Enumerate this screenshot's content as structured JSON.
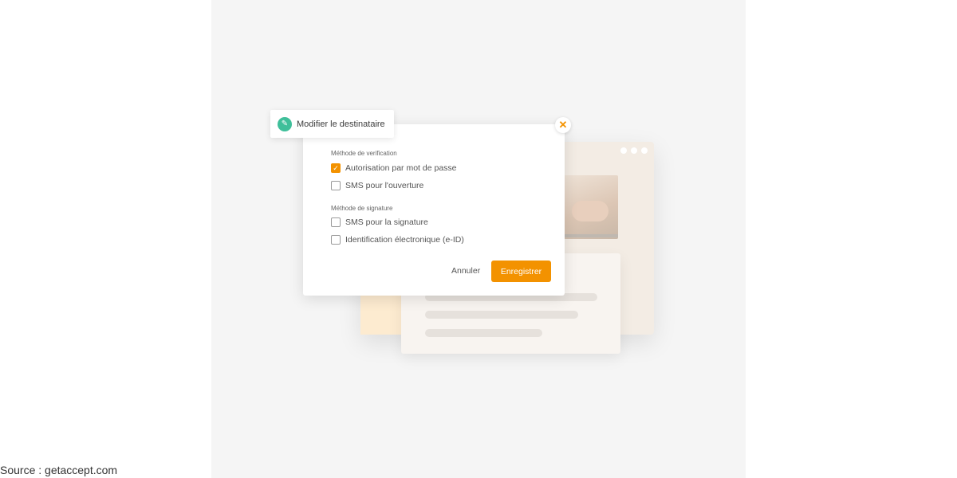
{
  "dialog": {
    "title": "Modifier le destinataire",
    "verification_label": "Méthode de verification",
    "verification_options": [
      {
        "label": "Autorisation par mot de passe",
        "checked": true
      },
      {
        "label": "SMS pour l'ouverture",
        "checked": false
      }
    ],
    "signature_label": "Méthode de signature",
    "signature_options": [
      {
        "label": "SMS pour la signature",
        "checked": false
      },
      {
        "label": "Identification électronique (e-ID)",
        "checked": false
      }
    ],
    "cancel_label": "Annuler",
    "save_label": "Enregistrer",
    "close_symbol": "✕"
  },
  "caption": "Source : getaccept.com",
  "colors": {
    "accent": "#f39200",
    "icon_green": "#3fbf9a"
  },
  "icons": {
    "header": "pencil-icon",
    "close": "close-icon",
    "check": "checkmark-icon"
  }
}
